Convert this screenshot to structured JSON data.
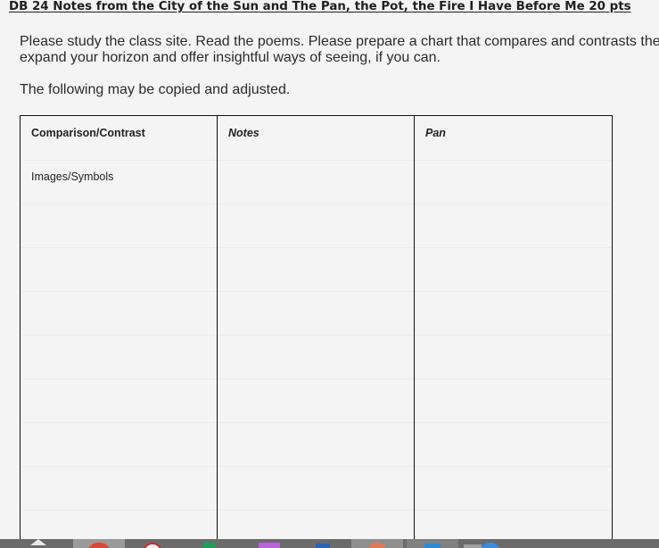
{
  "page": {
    "title": "DB 24 Notes from the City of the Sun and The Pan, the Pot, the Fire I Have Before Me 20 pts",
    "intro_line1": "Please study the class site. Read the poems. Please prepare a chart that compares and contrasts the",
    "intro_line2": "expand your horizon and offer insightful ways of seeing, if you can.",
    "copy_note": "The following may be copied and adjusted."
  },
  "table": {
    "headers": [
      "Comparison/Contrast",
      "Notes",
      "Pan"
    ],
    "rows": [
      [
        "Images/Symbols",
        "",
        ""
      ]
    ]
  },
  "taskbar": {
    "icons": [
      "show-hidden-icons-icon",
      "chrome-icon",
      "opera-icon",
      "sheets-icon",
      "app-icon",
      "word-icon",
      "browser-icon",
      "media-icon",
      "mail-icon",
      "chat-icon"
    ],
    "colors": {
      "background": "#6b6b6b",
      "chrome": "#d9473a",
      "opera": "#d1262b",
      "sheets": "#1e9e5a",
      "app": "#b764d8",
      "word": "#2a64b4",
      "mail": "#2b8ad6",
      "chat": "#3b8be0"
    }
  }
}
